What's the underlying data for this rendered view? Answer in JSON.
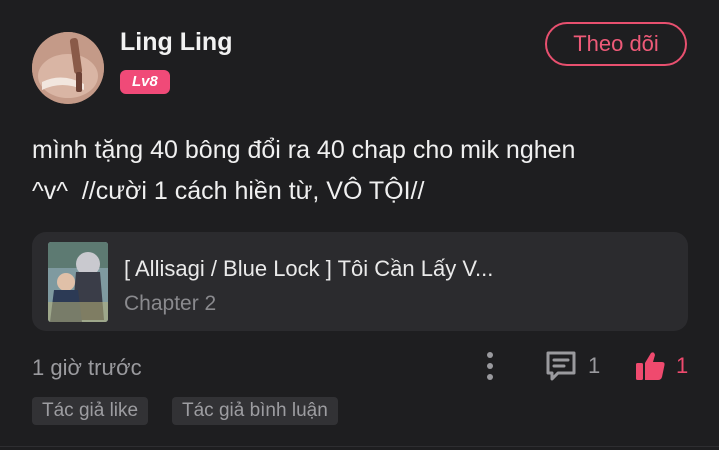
{
  "user": {
    "name": "Ling Ling",
    "level": "Lv8",
    "follow_label": "Theo dõi"
  },
  "comment": {
    "line1": "mình tặng 40 bông đổi ra 40 chap cho mik nghen",
    "line2": "^v^  //cười 1 cách hiền từ, VÔ TỘI//"
  },
  "manga": {
    "title": "[ Allisagi / Blue Lock ] Tôi Cần Lấy V...",
    "chapter": "Chapter 2"
  },
  "footer": {
    "time": "1 giờ trước",
    "reply_count": "1",
    "like_count": "1"
  },
  "tags": [
    "Tác giả like",
    "Tác giả bình luận"
  ],
  "icons": {
    "more": "more-vertical-icon",
    "reply": "comment-bubble-icon",
    "like": "thumbs-up-icon"
  },
  "colors": {
    "background": "#1e1e20",
    "accent": "#ee5a78",
    "badge": "#f04a78",
    "card": "#2b2b2e",
    "muted": "#9a9a9e"
  }
}
